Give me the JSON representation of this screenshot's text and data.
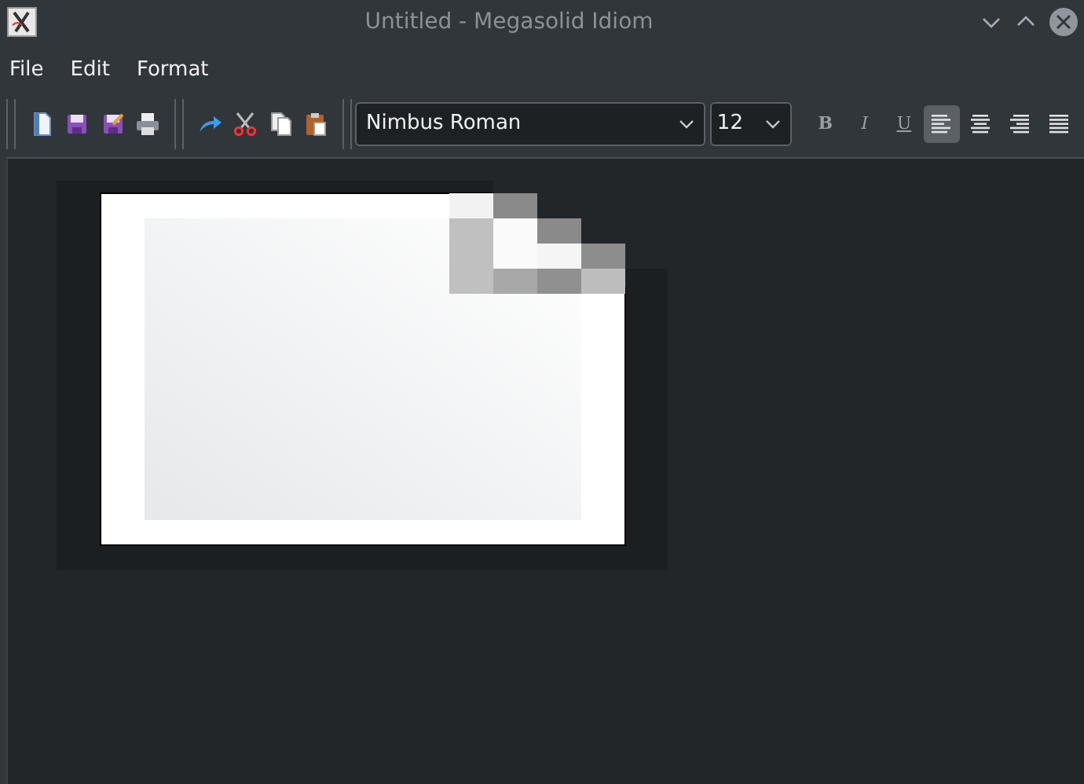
{
  "window": {
    "title": "Untitled - Megasolid Idiom"
  },
  "menu": [
    {
      "label": "File"
    },
    {
      "label": "Edit"
    },
    {
      "label": "Format"
    }
  ],
  "toolbar": {
    "font": {
      "value": "Nimbus Roman"
    },
    "size": {
      "value": "12"
    },
    "style_buttons": [
      {
        "label": "B",
        "kind": "bold"
      },
      {
        "label": "I",
        "kind": "italic"
      },
      {
        "label": "U",
        "kind": "underline"
      }
    ],
    "align_buttons": [
      {
        "kind": "left",
        "selected": true
      },
      {
        "kind": "center",
        "selected": false
      },
      {
        "kind": "right",
        "selected": false
      },
      {
        "kind": "justify",
        "selected": false
      }
    ]
  }
}
